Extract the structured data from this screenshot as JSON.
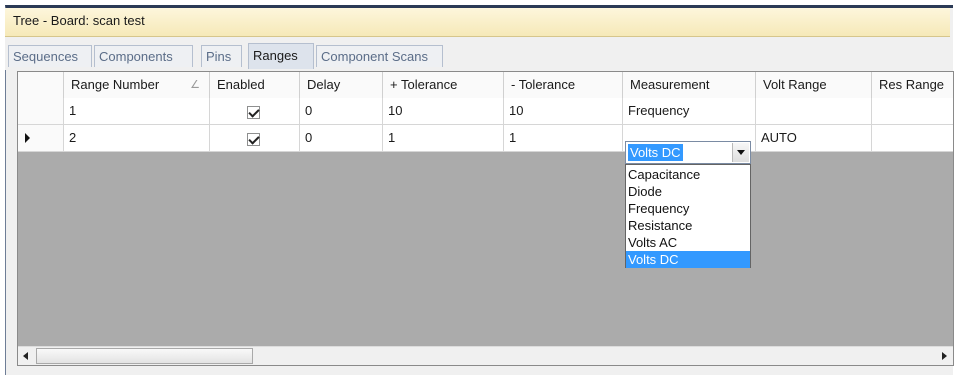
{
  "window": {
    "title": "Tree - Board: scan test"
  },
  "tabs": [
    {
      "label": "Sequences",
      "active": false
    },
    {
      "label": "Components",
      "active": false
    },
    {
      "label": "Pins",
      "active": false
    },
    {
      "label": "Ranges",
      "active": true
    },
    {
      "label": "Component Scans",
      "active": false
    }
  ],
  "grid": {
    "columns": [
      "Range Number",
      "Enabled",
      "Delay",
      "+ Tolerance",
      "- Tolerance",
      "Measurement",
      "Volt Range",
      "Res Range"
    ],
    "rows": [
      {
        "range_number": "1",
        "enabled": true,
        "delay": "0",
        "plus_tolerance": "10",
        "minus_tolerance": "10",
        "measurement": "Frequency",
        "volt_range": "",
        "res_range": "",
        "current": false
      },
      {
        "range_number": "2",
        "enabled": true,
        "delay": "0",
        "plus_tolerance": "1",
        "minus_tolerance": "1",
        "measurement": "Volts DC",
        "volt_range": "AUTO",
        "res_range": "",
        "current": true
      }
    ]
  },
  "measurement_dropdown": {
    "selected": "Volts DC",
    "options": [
      "Capacitance",
      "Diode",
      "Frequency",
      "Resistance",
      "Volts AC",
      "Volts DC"
    ]
  },
  "icons": {
    "sort": "sort-indicator-icon",
    "row_pointer": "row-pointer-icon",
    "dropdown_arrow": "chevron-down-icon",
    "scroll_left": "scroll-left-arrow-icon",
    "scroll_right": "scroll-right-arrow-icon"
  },
  "colors": {
    "selection": "#3399ff",
    "grid_background": "#ababab",
    "titlebar": "#f6e9b8"
  }
}
